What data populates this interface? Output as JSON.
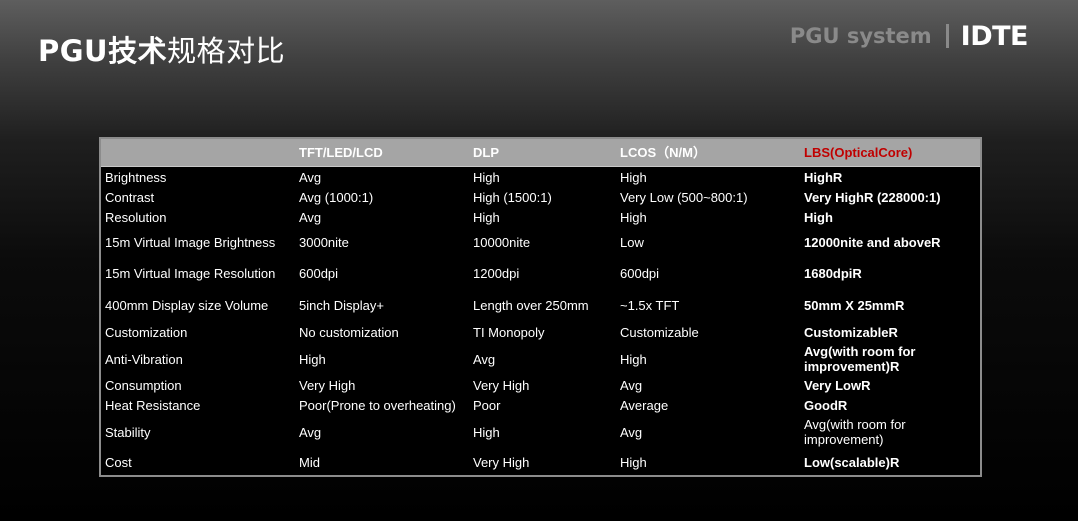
{
  "slide": {
    "title_bold": "PGU技术",
    "title_light": "规格对比",
    "brand_system": "PGU system",
    "brand_logo": "IDTE"
  },
  "colors": {
    "header_bg": "#a5a5a5",
    "lbs_header": "#c00000",
    "border": "#8c8c8c"
  },
  "table": {
    "headers": [
      "",
      "TFT/LED/LCD",
      "DLP",
      "LCOS（N/M）",
      "LBS(OpticalCore)"
    ],
    "rows": [
      {
        "h": 20,
        "cells": [
          "Brightness",
          "Avg",
          "High",
          "High",
          "HighR"
        ]
      },
      {
        "h": 20,
        "cells": [
          "Contrast",
          "Avg (1000:1)",
          "High (1500:1)",
          "Very Low (500~800:1)",
          "Very HighR (228000:1)"
        ]
      },
      {
        "h": 20,
        "cells": [
          "Resolution",
          "Avg",
          "High",
          "High",
          "High"
        ]
      },
      {
        "h": 30,
        "cells": [
          "15m Virtual Image Brightness",
          "3000nite",
          "10000nite",
          "Low",
          "12000nite and aboveR"
        ]
      },
      {
        "h": 32,
        "cells": [
          "15m Virtual Image Resolution",
          "600dpi",
          "1200dpi",
          "600dpi",
          "1680dpiR"
        ]
      },
      {
        "h": 32,
        "cells": [
          "400mm Display size Volume",
          "5inch Display+",
          "Length over 250mm",
          "~1.5x TFT",
          "50mm X 25mmR"
        ]
      },
      {
        "h": 22,
        "cells": [
          "Customization",
          "No customization",
          "TI Monopoly",
          "Customizable",
          "CustomizableR"
        ]
      },
      {
        "h": 32,
        "cells": [
          "Anti-Vibration",
          "High",
          "Avg",
          "High",
          "Avg(with room for improvement)R"
        ]
      },
      {
        "h": 20,
        "cells": [
          "Consumption",
          "Very High",
          "Very High",
          "Avg",
          "Very LowR"
        ]
      },
      {
        "h": 20,
        "cells": [
          "Heat Resistance",
          "Poor(Prone to overheating)",
          "Poor",
          "Average",
          "GoodR"
        ]
      },
      {
        "h": 34,
        "cells": [
          "Stability",
          "Avg",
          "High",
          "Avg",
          "Avg(with room for improvement)"
        ]
      },
      {
        "h": 26,
        "cells": [
          "Cost",
          "Mid",
          "Very High",
          "High",
          "Low(scalable)R"
        ]
      }
    ]
  }
}
